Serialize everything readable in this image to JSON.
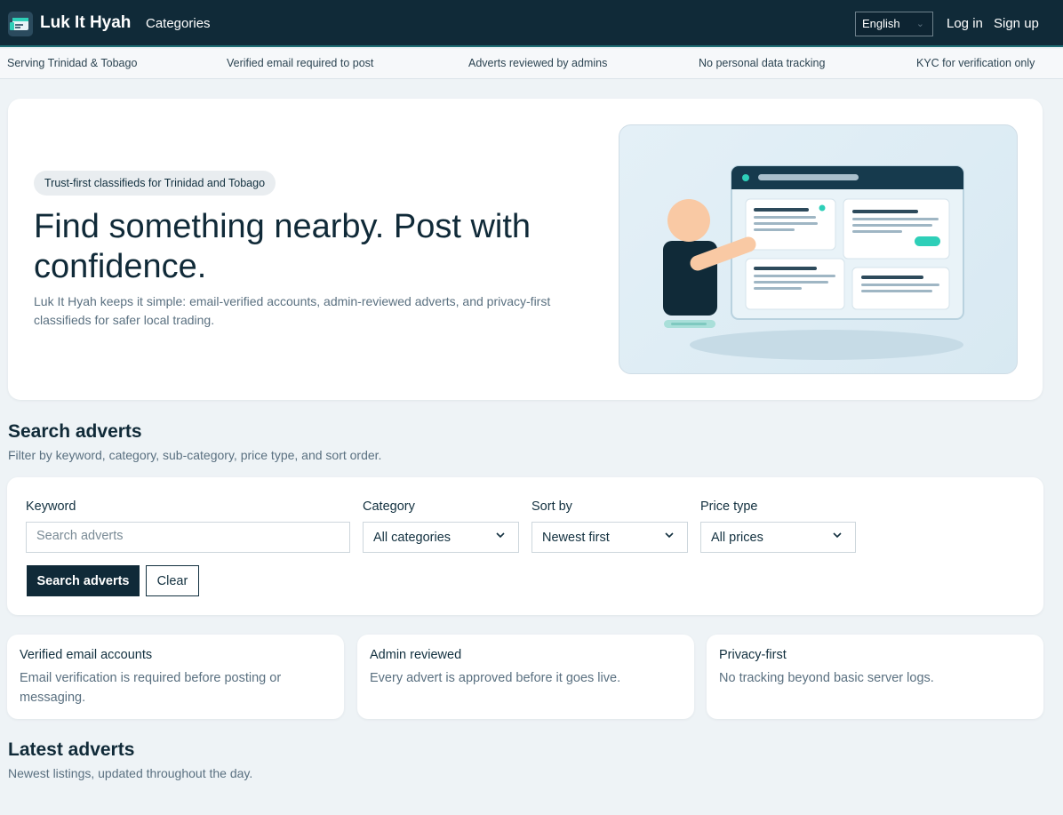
{
  "header": {
    "brand": "Luk It Hyah",
    "nav_categories": "Categories",
    "language": "English",
    "login": "Log in",
    "signup": "Sign up"
  },
  "trust_strip": [
    "Serving Trinidad & Tobago",
    "Verified email required to post",
    "Adverts reviewed by admins",
    "No personal data tracking",
    "KYC for verification only"
  ],
  "hero": {
    "pill": "Trust-first classifieds for Trinidad and Tobago",
    "title": "Find something nearby. Post with confidence.",
    "copy": "Luk It Hyah keeps it simple: email-verified accounts, admin-reviewed adverts, and privacy-first classifieds for safer local trading."
  },
  "search": {
    "heading": "Search adverts",
    "subheading": "Filter by keyword, category, sub-category, price type, and sort order.",
    "keyword_label": "Keyword",
    "keyword_placeholder": "Search adverts",
    "category_label": "Category",
    "category_value": "All categories",
    "sort_label": "Sort by",
    "sort_value": "Newest first",
    "price_label": "Price type",
    "price_value": "All prices",
    "search_button": "Search adverts",
    "clear_button": "Clear"
  },
  "features": [
    {
      "title": "Verified email accounts",
      "body": "Email verification is required before posting or messaging."
    },
    {
      "title": "Admin reviewed",
      "body": "Every advert is approved before it goes live."
    },
    {
      "title": "Privacy-first",
      "body": "No tracking beyond basic server logs."
    }
  ],
  "latest": {
    "heading": "Latest adverts",
    "subheading": "Newest listings, updated throughout the day."
  },
  "colors": {
    "nav_bg": "#102a38",
    "accent": "#2ecfb8",
    "page_bg": "#eef3f6"
  },
  "icons": {
    "brand_logo": "brand-logo-icon",
    "select_chevron": "chevron-down-icon"
  }
}
